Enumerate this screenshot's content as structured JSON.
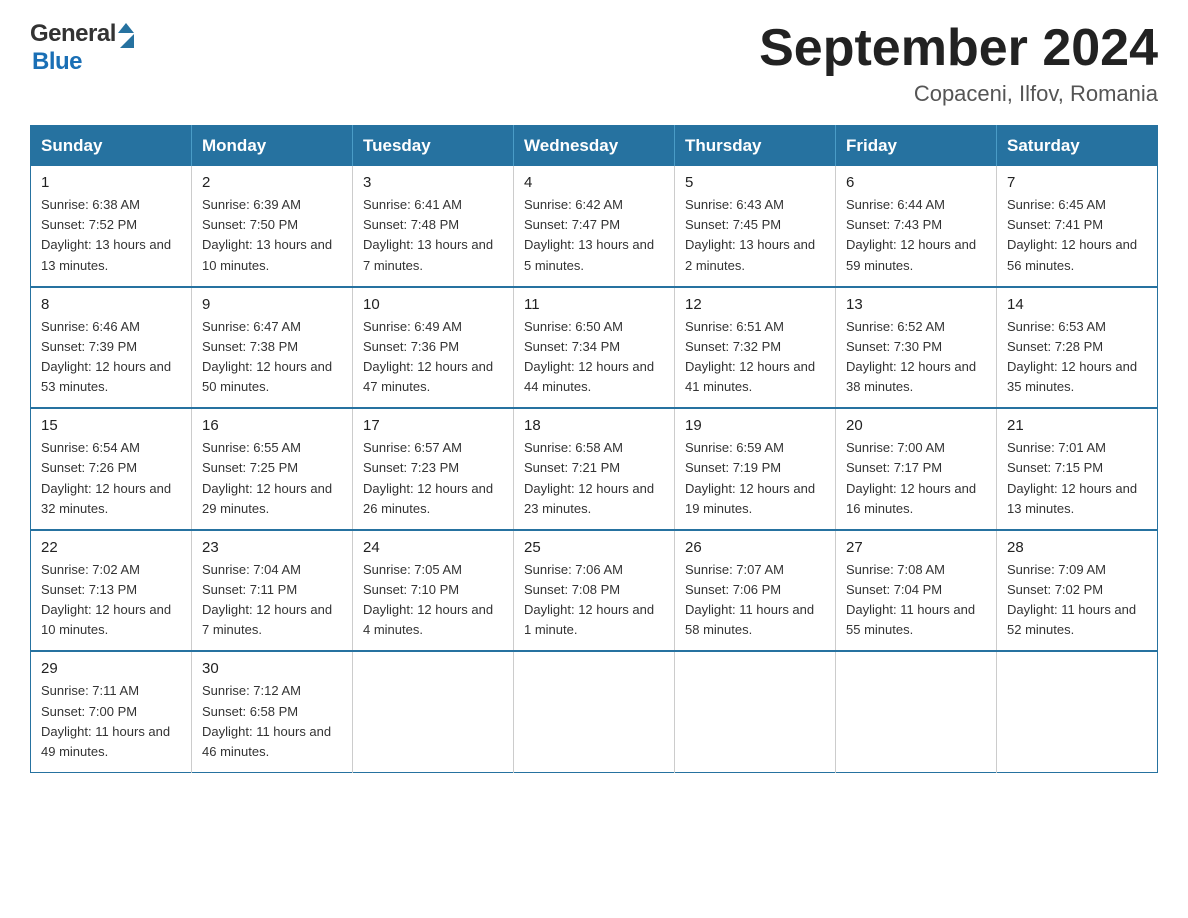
{
  "header": {
    "month_title": "September 2024",
    "location": "Copaceni, Ilfov, Romania",
    "logo_line1": "General",
    "logo_line2": "Blue"
  },
  "weekdays": [
    "Sunday",
    "Monday",
    "Tuesday",
    "Wednesday",
    "Thursday",
    "Friday",
    "Saturday"
  ],
  "weeks": [
    [
      {
        "day": "1",
        "sunrise": "6:38 AM",
        "sunset": "7:52 PM",
        "daylight": "13 hours and 13 minutes."
      },
      {
        "day": "2",
        "sunrise": "6:39 AM",
        "sunset": "7:50 PM",
        "daylight": "13 hours and 10 minutes."
      },
      {
        "day": "3",
        "sunrise": "6:41 AM",
        "sunset": "7:48 PM",
        "daylight": "13 hours and 7 minutes."
      },
      {
        "day": "4",
        "sunrise": "6:42 AM",
        "sunset": "7:47 PM",
        "daylight": "13 hours and 5 minutes."
      },
      {
        "day": "5",
        "sunrise": "6:43 AM",
        "sunset": "7:45 PM",
        "daylight": "13 hours and 2 minutes."
      },
      {
        "day": "6",
        "sunrise": "6:44 AM",
        "sunset": "7:43 PM",
        "daylight": "12 hours and 59 minutes."
      },
      {
        "day": "7",
        "sunrise": "6:45 AM",
        "sunset": "7:41 PM",
        "daylight": "12 hours and 56 minutes."
      }
    ],
    [
      {
        "day": "8",
        "sunrise": "6:46 AM",
        "sunset": "7:39 PM",
        "daylight": "12 hours and 53 minutes."
      },
      {
        "day": "9",
        "sunrise": "6:47 AM",
        "sunset": "7:38 PM",
        "daylight": "12 hours and 50 minutes."
      },
      {
        "day": "10",
        "sunrise": "6:49 AM",
        "sunset": "7:36 PM",
        "daylight": "12 hours and 47 minutes."
      },
      {
        "day": "11",
        "sunrise": "6:50 AM",
        "sunset": "7:34 PM",
        "daylight": "12 hours and 44 minutes."
      },
      {
        "day": "12",
        "sunrise": "6:51 AM",
        "sunset": "7:32 PM",
        "daylight": "12 hours and 41 minutes."
      },
      {
        "day": "13",
        "sunrise": "6:52 AM",
        "sunset": "7:30 PM",
        "daylight": "12 hours and 38 minutes."
      },
      {
        "day": "14",
        "sunrise": "6:53 AM",
        "sunset": "7:28 PM",
        "daylight": "12 hours and 35 minutes."
      }
    ],
    [
      {
        "day": "15",
        "sunrise": "6:54 AM",
        "sunset": "7:26 PM",
        "daylight": "12 hours and 32 minutes."
      },
      {
        "day": "16",
        "sunrise": "6:55 AM",
        "sunset": "7:25 PM",
        "daylight": "12 hours and 29 minutes."
      },
      {
        "day": "17",
        "sunrise": "6:57 AM",
        "sunset": "7:23 PM",
        "daylight": "12 hours and 26 minutes."
      },
      {
        "day": "18",
        "sunrise": "6:58 AM",
        "sunset": "7:21 PM",
        "daylight": "12 hours and 23 minutes."
      },
      {
        "day": "19",
        "sunrise": "6:59 AM",
        "sunset": "7:19 PM",
        "daylight": "12 hours and 19 minutes."
      },
      {
        "day": "20",
        "sunrise": "7:00 AM",
        "sunset": "7:17 PM",
        "daylight": "12 hours and 16 minutes."
      },
      {
        "day": "21",
        "sunrise": "7:01 AM",
        "sunset": "7:15 PM",
        "daylight": "12 hours and 13 minutes."
      }
    ],
    [
      {
        "day": "22",
        "sunrise": "7:02 AM",
        "sunset": "7:13 PM",
        "daylight": "12 hours and 10 minutes."
      },
      {
        "day": "23",
        "sunrise": "7:04 AM",
        "sunset": "7:11 PM",
        "daylight": "12 hours and 7 minutes."
      },
      {
        "day": "24",
        "sunrise": "7:05 AM",
        "sunset": "7:10 PM",
        "daylight": "12 hours and 4 minutes."
      },
      {
        "day": "25",
        "sunrise": "7:06 AM",
        "sunset": "7:08 PM",
        "daylight": "12 hours and 1 minute."
      },
      {
        "day": "26",
        "sunrise": "7:07 AM",
        "sunset": "7:06 PM",
        "daylight": "11 hours and 58 minutes."
      },
      {
        "day": "27",
        "sunrise": "7:08 AM",
        "sunset": "7:04 PM",
        "daylight": "11 hours and 55 minutes."
      },
      {
        "day": "28",
        "sunrise": "7:09 AM",
        "sunset": "7:02 PM",
        "daylight": "11 hours and 52 minutes."
      }
    ],
    [
      {
        "day": "29",
        "sunrise": "7:11 AM",
        "sunset": "7:00 PM",
        "daylight": "11 hours and 49 minutes."
      },
      {
        "day": "30",
        "sunrise": "7:12 AM",
        "sunset": "6:58 PM",
        "daylight": "11 hours and 46 minutes."
      },
      null,
      null,
      null,
      null,
      null
    ]
  ]
}
